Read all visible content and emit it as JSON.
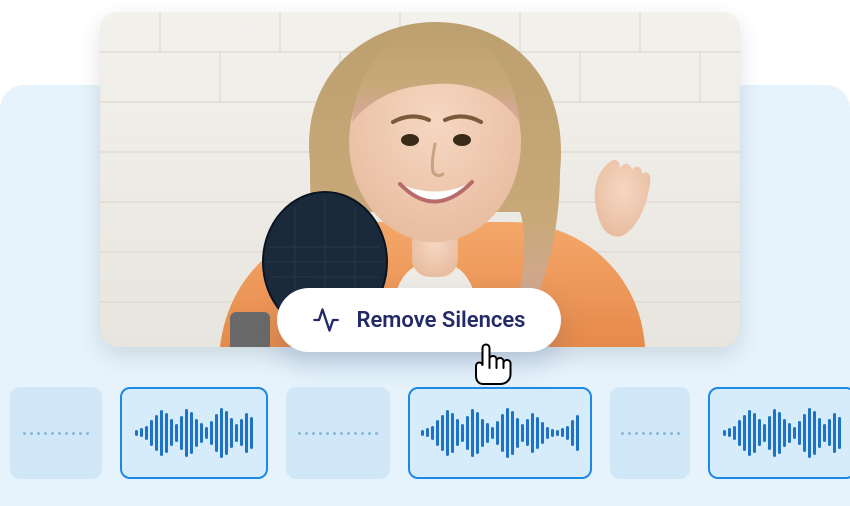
{
  "button": {
    "label": "Remove Silences",
    "icon_name": "activity-icon"
  },
  "cursor": {
    "icon_name": "pointer-cursor-icon"
  },
  "preview": {
    "alt": "Person with microphone video preview"
  },
  "colors": {
    "accent": "#1e88e5",
    "text": "#222a68",
    "panel_bg": "#e6f3fc",
    "clip_active_bg": "#d6ecfb",
    "clip_silence_bg": "#d0e7f7"
  },
  "timeline": {
    "clips": [
      {
        "type": "silence"
      },
      {
        "type": "audio"
      },
      {
        "type": "silence"
      },
      {
        "type": "audio"
      },
      {
        "type": "silence"
      },
      {
        "type": "audio"
      },
      {
        "type": "silence"
      }
    ]
  }
}
